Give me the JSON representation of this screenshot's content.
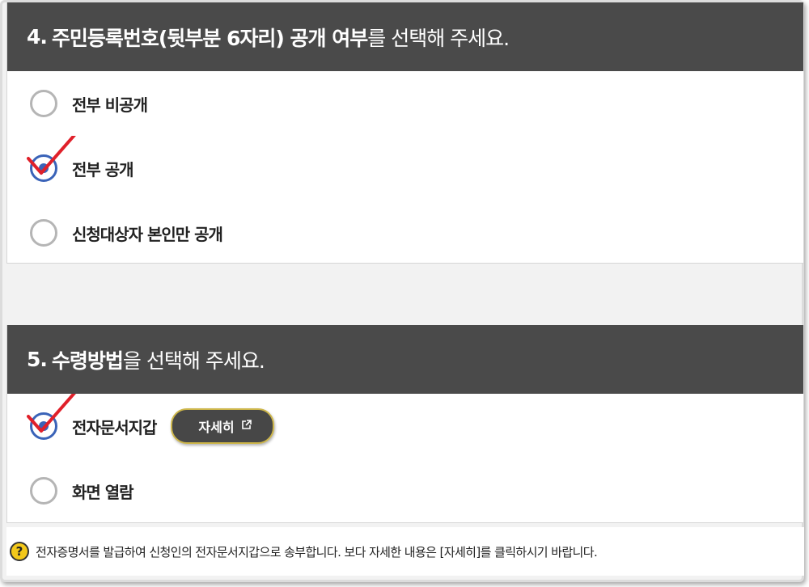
{
  "section4": {
    "number": "4.",
    "title_bold": "주민등록번호(뒷부분 6자리) 공개 여부",
    "title_rest": "를 선택해 주세요.",
    "options": [
      {
        "label": "전부 비공개",
        "checked": false
      },
      {
        "label": "전부 공개",
        "checked": true
      },
      {
        "label": "신청대상자 본인만 공개",
        "checked": false
      }
    ]
  },
  "section5": {
    "number": "5.",
    "title_bold": "수령방법",
    "title_rest": "을 선택해 주세요.",
    "options": [
      {
        "label": "전자문서지갑",
        "checked": true
      },
      {
        "label": "화면 열람",
        "checked": false
      }
    ],
    "detail_button": "자세히",
    "detail_icon": "external-link-icon"
  },
  "note": {
    "icon": "question-icon",
    "icon_glyph": "?",
    "text": "전자증명서를 발급하여 신청인의 전자문서지갑으로 송부합니다. 보다 자세한 내용은 [자세히]를 클릭하시기 바랍니다."
  },
  "colors": {
    "header_bg": "#4a4a4a",
    "radio_checked": "#3a63b8",
    "check_mark": "#e0202a",
    "button_border": "#cdb64a",
    "note_icon": "#f3c81a"
  }
}
